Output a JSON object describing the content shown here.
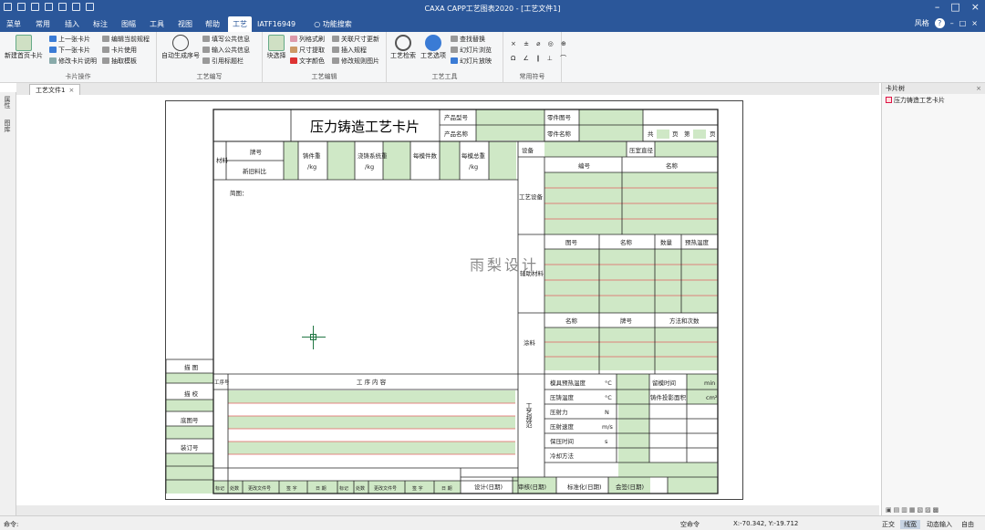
{
  "titlebar": {
    "title": "CAXA CAPP工艺图表2020 - [工艺文件1]"
  },
  "tabs": [
    {
      "label": "菜单",
      "id": "menu"
    },
    {
      "label": "常用",
      "id": "common"
    },
    {
      "label": "插入",
      "id": "insert"
    },
    {
      "label": "标注",
      "id": "annotate"
    },
    {
      "label": "图幅",
      "id": "sheet"
    },
    {
      "label": "工具",
      "id": "tools"
    },
    {
      "label": "视图",
      "id": "view"
    },
    {
      "label": "帮助",
      "id": "help"
    },
    {
      "label": "工艺",
      "id": "process",
      "active": true
    },
    {
      "label": "IATF16949",
      "id": "iatf"
    }
  ],
  "search": {
    "label": "功能搜索"
  },
  "user": {
    "name": "风格"
  },
  "ribbon": {
    "card_ops": {
      "label": "卡片操作",
      "new_card": "新建首页卡片",
      "prev": "上一张卡片",
      "next": "下一张卡片",
      "modify_card": "修改卡片说明",
      "edit_path": "编辑当前规程",
      "card_use": "卡片使用",
      "capture": "抽取模板"
    },
    "process_prep": {
      "label": "工艺编写",
      "auto_seq": "自动生成序号",
      "fill_public": "填写公共信息",
      "insert_public": "输入公共信息",
      "ref_title": "引用标题栏"
    },
    "process_edit": {
      "label": "工艺编辑",
      "block_fill": "块选择",
      "col_format": "列格式刷",
      "dim_extract": "尺寸提取",
      "text_color": "文字颜色",
      "related_size": "关联尺寸更新",
      "insert_rule": "插入规程",
      "modify_image": "修改规则图片"
    },
    "process_tools": {
      "label": "工艺工具",
      "check": "工艺检索",
      "options": "工艺选项",
      "search_replace": "查找替换",
      "slideshow": "幻灯片浏览",
      "slide_play": "幻灯片放映"
    },
    "symbols": {
      "label": "常用符号",
      "row1": "× ± ⌀ ◎ ⊕",
      "row2": "Ω ∠ ∥ ⊥ ⌒"
    }
  },
  "document_tab": "工艺文件1",
  "left_dock": [
    "属性",
    "图库"
  ],
  "card": {
    "title": "压力铸造工艺卡片",
    "product_model": "产品型号",
    "product_name": "产品名称",
    "part_no": "零件图号",
    "part_name": "零件名称",
    "total": "共",
    "pages": "页",
    "page_no": "第",
    "page": "页",
    "material": "材料",
    "grade": "牌号",
    "new_ratio": "新旧料比",
    "cast_weight": "铸件重",
    "cast_unit": "/kg",
    "sys_weight": "浇铸系统重",
    "sys_unit": "/kg",
    "per_mold": "每模件数",
    "mold_weight": "每模总重",
    "mold_unit": "/kg",
    "sketch": "简图：",
    "equipment": "设备",
    "clamp_force": "压室直径",
    "process_equipment": "工艺设备",
    "pe_no": "编号",
    "pe_name": "名称",
    "aux_material": "辅助材料",
    "am_no": "图号",
    "am_name": "名称",
    "am_qty": "数量",
    "am_temp": "预热温度",
    "paint": "涂料",
    "p_name": "名称",
    "p_grade": "牌号",
    "p_method": "方法和次数",
    "seq": "工序号",
    "content": "工 序 内 容",
    "params_label": "工艺规范",
    "params": [
      {
        "name": "模具预热温度",
        "unit": "°C"
      },
      {
        "name": "压铸温度",
        "unit": "°C"
      },
      {
        "name": "压射力",
        "unit": "N"
      },
      {
        "name": "压射速度",
        "unit": "m/s"
      },
      {
        "name": "保压时间",
        "unit": "s"
      },
      {
        "name": "冷却方法",
        "unit": ""
      }
    ],
    "hold_time": "留模时间",
    "hold_unit": "min",
    "specific_pressure": "铸件投影面积",
    "sp_unit": "cm²",
    "side": [
      "描 图",
      "描 校",
      "底图号",
      "装订号"
    ],
    "footer": [
      "标记",
      "处数",
      "更改文件号",
      "签 字",
      "日 期",
      "标记",
      "处数",
      "更改文件号",
      "签 字",
      "日 期"
    ],
    "sign": [
      "设计(日期)",
      "审核(日期)",
      "标准化(日期)",
      "会签(日期)"
    ]
  },
  "watermark": "雨梨设计",
  "right_panel": {
    "title": "卡片树",
    "item": "压力铸造工艺卡片"
  },
  "status": {
    "prompt": "命令:",
    "mode": "空命令",
    "coords": "X:-70.342, Y:-19.712",
    "ortho": "正交",
    "grid": "线宽",
    "dyn": "动态输入",
    "free": "自由"
  },
  "colors": {
    "titlebar": "#2b579a",
    "field": "#cfe8c6",
    "line_red": "#e06060"
  }
}
